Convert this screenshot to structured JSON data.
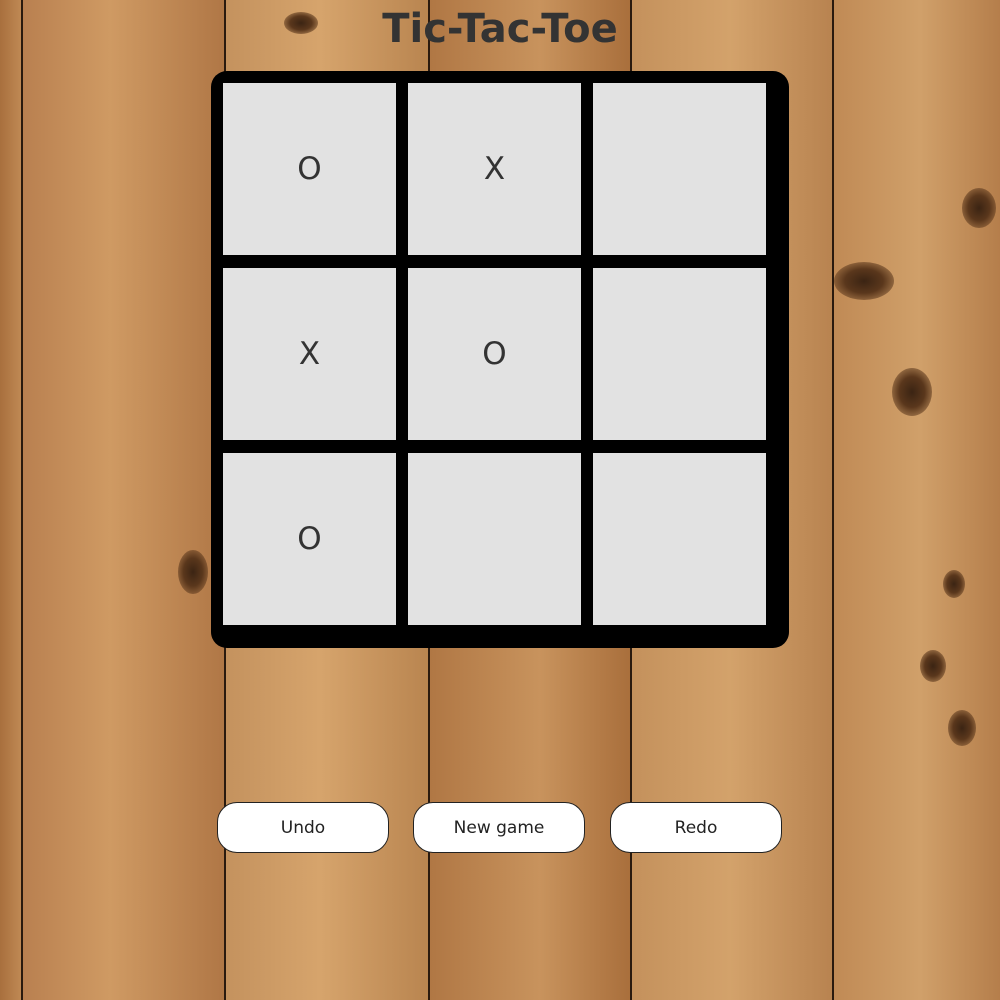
{
  "title": "Tic-Tac-Toe",
  "board": {
    "cells": [
      "O",
      "X",
      "",
      "X",
      "O",
      "",
      "O",
      "",
      ""
    ]
  },
  "buttons": {
    "undo": "Undo",
    "new_game": "New game",
    "redo": "Redo"
  },
  "colors": {
    "cell_background": "#e2e2e2",
    "board_border": "#000000",
    "mark_color": "#333333",
    "button_background": "#ffffff"
  }
}
